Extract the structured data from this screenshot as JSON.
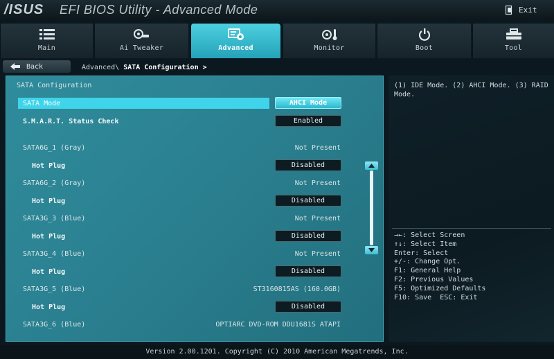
{
  "header": {
    "logo": "/ISUS",
    "title": "EFI BIOS Utility - Advanced Mode",
    "exit_label": "Exit"
  },
  "tabs": [
    {
      "label": "Main",
      "icon": "list-icon"
    },
    {
      "label": "Ai Tweaker",
      "icon": "tweaker-icon"
    },
    {
      "label": "Advanced",
      "icon": "advanced-icon",
      "active": true
    },
    {
      "label": "Monitor",
      "icon": "monitor-icon"
    },
    {
      "label": "Boot",
      "icon": "power-icon"
    },
    {
      "label": "Tool",
      "icon": "tool-icon"
    }
  ],
  "nav": {
    "back_label": "Back",
    "breadcrumb_parent": "Advanced\\",
    "breadcrumb_current": "SATA Configuration >"
  },
  "section_title": "SATA Configuration",
  "settings": {
    "sata_mode": {
      "label": "SATA Mode",
      "value": "AHCI Mode"
    },
    "smart": {
      "label": "S.M.A.R.T. Status Check",
      "value": "Enabled"
    },
    "ports": [
      {
        "label": "SATA6G_1 (Gray)",
        "status": "Not Present",
        "hotplug_label": "Hot Plug",
        "hotplug_value": "Disabled"
      },
      {
        "label": "SATA6G_2 (Gray)",
        "status": "Not Present",
        "hotplug_label": "Hot Plug",
        "hotplug_value": "Disabled"
      },
      {
        "label": "SATA3G_3 (Blue)",
        "status": "Not Present",
        "hotplug_label": "Hot Plug",
        "hotplug_value": "Disabled"
      },
      {
        "label": "SATA3G_4 (Blue)",
        "status": "Not Present",
        "hotplug_label": "Hot Plug",
        "hotplug_value": "Disabled"
      },
      {
        "label": "SATA3G_5 (Blue)",
        "status": "ST3160815AS (160.0GB)",
        "hotplug_label": "Hot Plug",
        "hotplug_value": "Disabled"
      },
      {
        "label": "SATA3G_6 (Blue)",
        "status": "OPTIARC DVD-ROM DDU1681S ATAPI"
      }
    ]
  },
  "help": {
    "description": "(1) IDE Mode. (2) AHCI Mode. (3) RAID Mode.",
    "keys": [
      "→←: Select Screen",
      "↑↓: Select Item",
      "Enter: Select",
      "+/-: Change Opt.",
      "F1: General Help",
      "F2: Previous Values",
      "F5: Optimized Defaults",
      "F10: Save  ESC: Exit"
    ]
  },
  "footer": "Version 2.00.1201. Copyright (C) 2010 American Megatrends, Inc.",
  "colors": {
    "accent": "#3fd4ea",
    "panel": "#2a7f8f",
    "background": "#0b1820"
  }
}
